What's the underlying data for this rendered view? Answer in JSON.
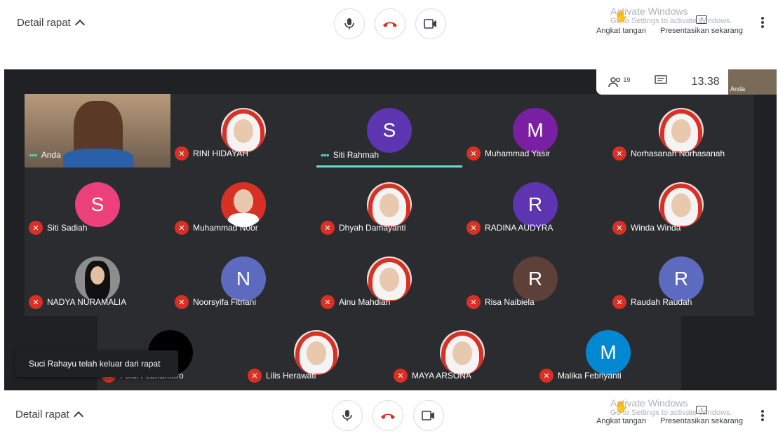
{
  "toolbar_top": {
    "details_label": "Detail rapat",
    "raise_hand_label": "Angkat tangan",
    "present_label": "Presentasikan sekarang"
  },
  "toolbar_bottom": {
    "details_label": "Detail rapat",
    "raise_hand_label": "Angkat tangan",
    "present_label": "Presentasikan sekarang"
  },
  "watermark": {
    "title": "Activate Windows",
    "subtitle": "Go to Settings to activate Windows."
  },
  "info": {
    "participants_count": "19",
    "time": "13.38",
    "self_label": "Anda"
  },
  "participants": [
    {
      "name": "Anda",
      "initial": "",
      "color": ""
    },
    {
      "name": "RINI HIDAYAH",
      "initial": "",
      "color": "#d93025"
    },
    {
      "name": "Siti Rahmah",
      "initial": "S",
      "color": "#5e35b1"
    },
    {
      "name": "Muhammad Yasir",
      "initial": "M",
      "color": "#7b1fa2"
    },
    {
      "name": "Norhasanah Norhasanah",
      "initial": "",
      "color": "#d93025"
    },
    {
      "name": "Siti Sadiah",
      "initial": "S",
      "color": "#ec407a"
    },
    {
      "name": "Muhammad Noor",
      "initial": "",
      "color": "#d93025"
    },
    {
      "name": "Dhyah Damayanti",
      "initial": "",
      "color": "#d93025"
    },
    {
      "name": "RADINA AUDYRA",
      "initial": "R",
      "color": "#5e35b1"
    },
    {
      "name": "Winda Winda",
      "initial": "",
      "color": "#d93025"
    },
    {
      "name": "NADYA NURAMALIA",
      "initial": "",
      "color": "#8d8d8d"
    },
    {
      "name": "Noorsyifa Fitriani",
      "initial": "N",
      "color": "#5c6bc0"
    },
    {
      "name": "Ainu Mahdiah",
      "initial": "",
      "color": "#d93025"
    },
    {
      "name": "Risa Naibiela",
      "initial": "R",
      "color": "#5d4037"
    },
    {
      "name": "Raudah Raudah",
      "initial": "R",
      "color": "#5c6bc0"
    },
    {
      "name": "Feldi Febriantoro",
      "initial": "",
      "color": "#000000"
    },
    {
      "name": "Lilis Herawati",
      "initial": "",
      "color": "#d93025"
    },
    {
      "name": "MAYA ARSONA",
      "initial": "",
      "color": "#d93025"
    },
    {
      "name": "Malika Febriyanti",
      "initial": "M",
      "color": "#0288d1"
    }
  ],
  "toast": {
    "message": "Suci Rahayu telah keluar dari rapat"
  }
}
